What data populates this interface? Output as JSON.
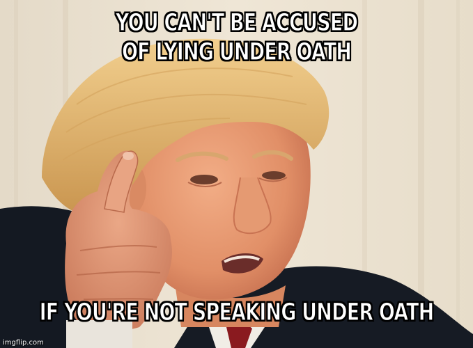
{
  "meme": {
    "top_text": "YOU CAN'T BE ACCUSED\nOF LYING UNDER OATH",
    "bottom_text": "IF YOU'RE NOT SPEAKING UNDER OATH",
    "watermark": "imgflip.com"
  },
  "colors": {
    "caption_fill": "#ffffff",
    "caption_outline": "#000000",
    "background_wall": "#e9dfcf",
    "suit": "#151a22",
    "hair": "#e0b46a",
    "skin": "#e99a72",
    "tie": "#8a1a1f"
  }
}
